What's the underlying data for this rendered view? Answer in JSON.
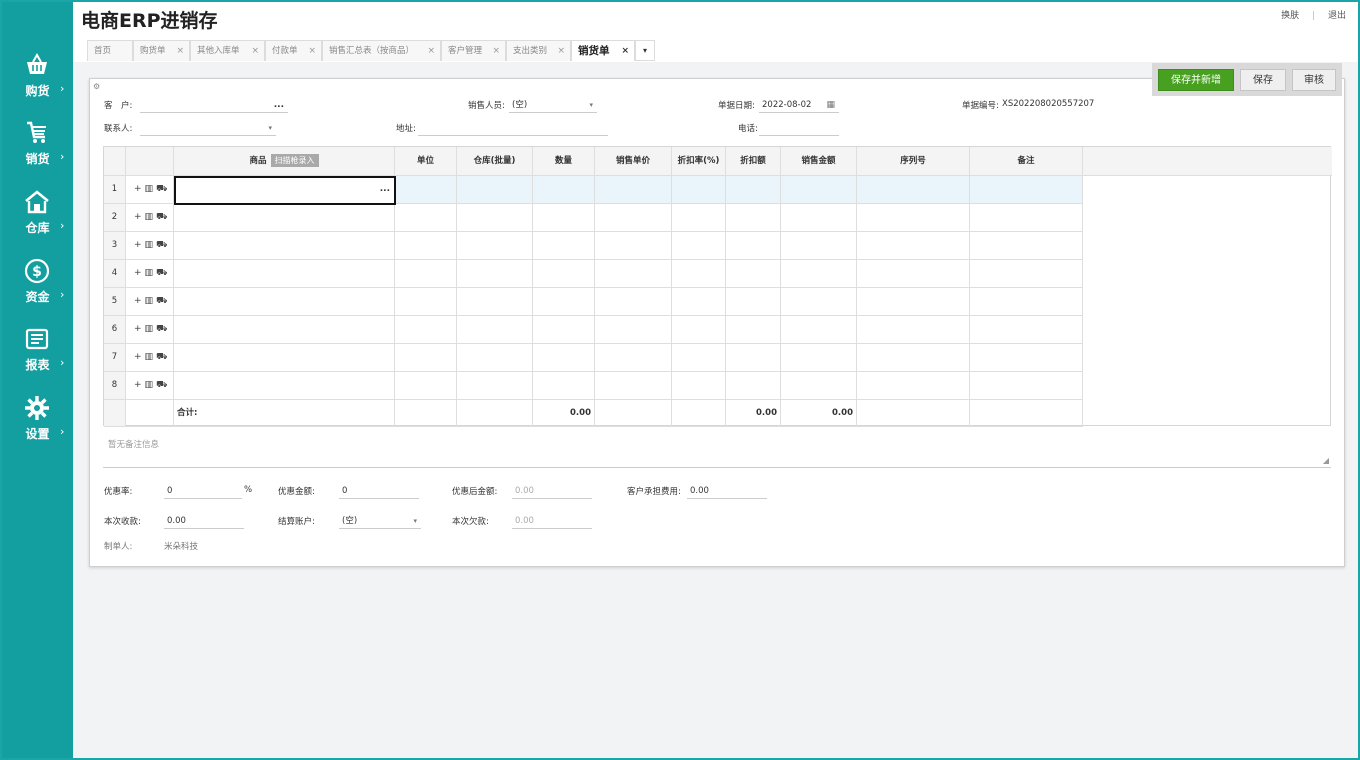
{
  "app": {
    "title": "电商ERP进销存",
    "links": {
      "skin": "换肤",
      "logout": "退出"
    }
  },
  "sidebar": [
    {
      "label": "购货",
      "icon": "basket-icon"
    },
    {
      "label": "销货",
      "icon": "cart-icon"
    },
    {
      "label": "仓库",
      "icon": "warehouse-icon"
    },
    {
      "label": "资金",
      "icon": "dollar-icon"
    },
    {
      "label": "报表",
      "icon": "report-icon"
    },
    {
      "label": "设置",
      "icon": "gear-icon"
    }
  ],
  "tabs": [
    {
      "label": "首页"
    },
    {
      "label": "购货单"
    },
    {
      "label": "其他入库单"
    },
    {
      "label": "付款单"
    },
    {
      "label": "销售汇总表（按商品）"
    },
    {
      "label": "客户管理"
    },
    {
      "label": "支出类别"
    },
    {
      "label": "销货单",
      "active": true
    }
  ],
  "buttons": {
    "save_new": "保存并新增",
    "save": "保存",
    "audit": "审核"
  },
  "form": {
    "customer_label": "客　户:",
    "customer_value": "",
    "customer_btn": "...",
    "salesperson_label": "销售人员:",
    "salesperson_value": "(空)",
    "date_label": "单据日期:",
    "date_value": "2022-08-02",
    "docno_label": "单据编号:",
    "docno_value": "XS202208020557207",
    "contact_label": "联系人:",
    "contact_value": "",
    "address_label": "地址:",
    "address_value": "",
    "phone_label": "电话:",
    "phone_value": ""
  },
  "grid": {
    "columns": [
      "商品",
      "单位",
      "仓库(批量)",
      "数量",
      "销售单价",
      "折扣率(%)",
      "折扣额",
      "销售金额",
      "序列号",
      "备注"
    ],
    "scan_label": "扫描枪录入",
    "row_numbers": [
      "1",
      "2",
      "3",
      "4",
      "5",
      "6",
      "7",
      "8"
    ],
    "row_actions": [
      "+",
      "▥",
      "⛟"
    ],
    "edit_btn": "...",
    "total_label": "合计:",
    "totals": {
      "qty": "0.00",
      "discount": "0.00",
      "amount": "0.00"
    }
  },
  "remark": {
    "placeholder": "暂无备注信息"
  },
  "footer": {
    "discount_rate_label": "优惠率:",
    "discount_rate_value": "0",
    "percent": "%",
    "discount_amount_label": "优惠金额:",
    "discount_amount_value": "0",
    "after_discount_label": "优惠后金额:",
    "after_discount_value": "0.00",
    "customer_fee_label": "客户承担费用:",
    "customer_fee_value": "0.00",
    "received_label": "本次收款:",
    "received_value": "0.00",
    "account_label": "结算账户:",
    "account_value": "(空)",
    "owed_label": "本次欠款:",
    "owed_value": "0.00",
    "maker_label": "制单人:",
    "maker_value": "米朵科技"
  }
}
